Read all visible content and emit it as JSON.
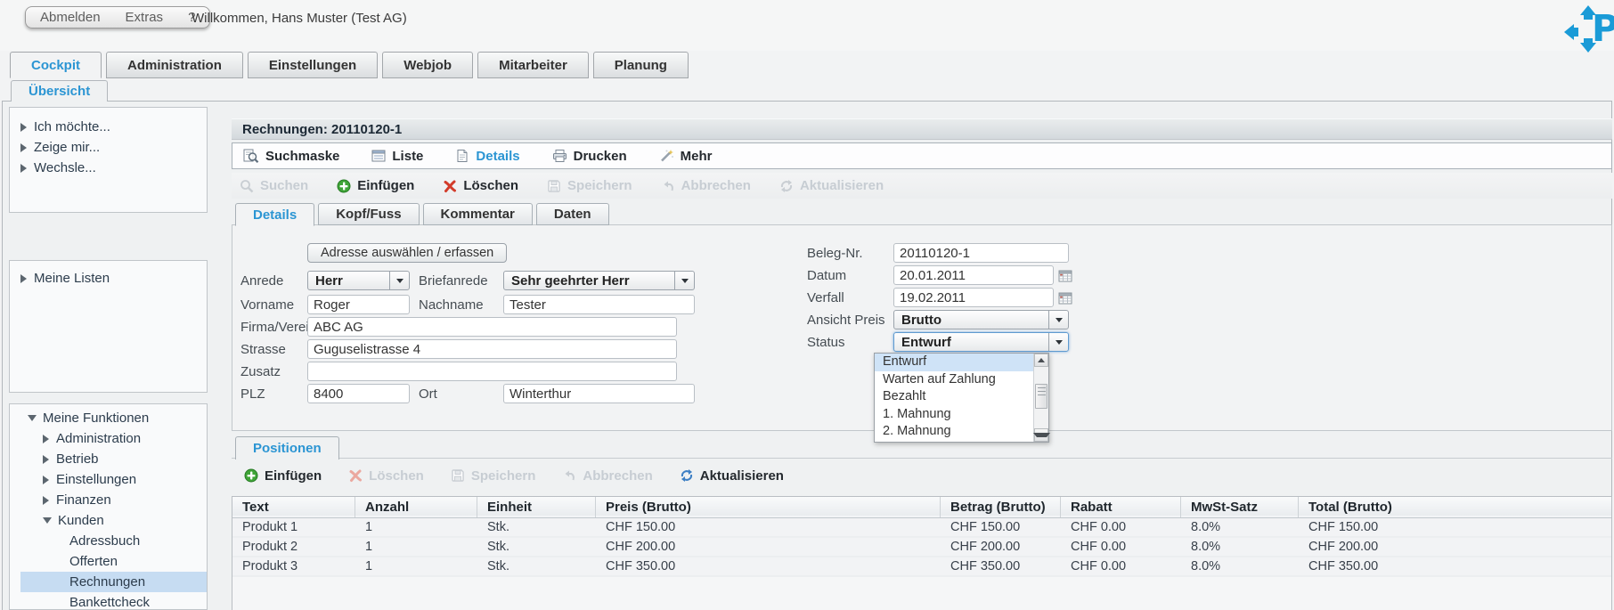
{
  "colors": {
    "accent": "#2b95d3",
    "selection": "#c6dcf2",
    "green": "#2f9e2f",
    "red": "#d23b2a",
    "refresh_blue": "#3d7fc4",
    "logo_blue": "#1a9bd7"
  },
  "top": {
    "menu": [
      {
        "label": "Abmelden"
      },
      {
        "label": "Extras"
      },
      {
        "label": "?"
      }
    ],
    "welcome": "Willkommen, Hans Muster (Test AG)",
    "logo_letter": "P"
  },
  "main_tabs": [
    {
      "label": "Cockpit"
    },
    {
      "label": "Administration"
    },
    {
      "label": "Einstellungen"
    },
    {
      "label": "Webjob"
    },
    {
      "label": "Mitarbeiter"
    },
    {
      "label": "Planung"
    }
  ],
  "subtab_label": "Übersicht",
  "sidebar": {
    "quick": [
      {
        "label": "Ich möchte..."
      },
      {
        "label": "Zeige mir..."
      },
      {
        "label": "Wechsle..."
      }
    ],
    "lists_label": "Meine Listen",
    "functions_label": "Meine Funktionen",
    "functions": [
      {
        "label": "Administration"
      },
      {
        "label": "Betrieb"
      },
      {
        "label": "Einstellungen"
      },
      {
        "label": "Finanzen"
      },
      {
        "label": "Kunden"
      }
    ],
    "kunden_children": [
      {
        "label": "Adressbuch"
      },
      {
        "label": "Offerten"
      },
      {
        "label": "Rechnungen"
      },
      {
        "label": "Bankettcheck"
      }
    ]
  },
  "record_title": "Rechnungen: 20110120-1",
  "view_toolbar": [
    {
      "label": "Suchmaske"
    },
    {
      "label": "Liste"
    },
    {
      "label": "Details"
    },
    {
      "label": "Drucken"
    },
    {
      "label": "Mehr"
    }
  ],
  "action_toolbar": [
    {
      "label": "Suchen"
    },
    {
      "label": "Einfügen"
    },
    {
      "label": "Löschen"
    },
    {
      "label": "Speichern"
    },
    {
      "label": "Abbrechen"
    },
    {
      "label": "Aktualisieren"
    }
  ],
  "detail_tabs": [
    {
      "label": "Details"
    },
    {
      "label": "Kopf/Fuss"
    },
    {
      "label": "Kommentar"
    },
    {
      "label": "Daten"
    }
  ],
  "form": {
    "address_button": "Adresse auswählen / erfassen",
    "anrede": {
      "label": "Anrede",
      "value": "Herr"
    },
    "briefanrede": {
      "label": "Briefanrede",
      "value": "Sehr geehrter Herr"
    },
    "vorname": {
      "label": "Vorname",
      "value": "Roger"
    },
    "nachname": {
      "label": "Nachname",
      "value": "Tester"
    },
    "firma": {
      "label": "Firma/Verein",
      "value": "ABC AG"
    },
    "strasse": {
      "label": "Strasse",
      "value": "Guguselistrasse 4"
    },
    "zusatz": {
      "label": "Zusatz",
      "value": ""
    },
    "plz": {
      "label": "PLZ",
      "value": "8400"
    },
    "ort": {
      "label": "Ort",
      "value": "Winterthur"
    },
    "beleg": {
      "label": "Beleg-Nr.",
      "value": "20110120-1"
    },
    "datum": {
      "label": "Datum",
      "value": "20.01.2011"
    },
    "verfall": {
      "label": "Verfall",
      "value": "19.02.2011"
    },
    "ansicht_preis": {
      "label": "Ansicht Preis",
      "value": "Brutto"
    },
    "status": {
      "label": "Status",
      "value": "Entwurf"
    }
  },
  "status_options": [
    {
      "label": "Entwurf"
    },
    {
      "label": "Warten auf Zahlung"
    },
    {
      "label": "Bezahlt"
    },
    {
      "label": "1. Mahnung"
    },
    {
      "label": "2. Mahnung"
    }
  ],
  "positions": {
    "tab_label": "Positionen",
    "toolbar": [
      {
        "label": "Einfügen"
      },
      {
        "label": "Löschen"
      },
      {
        "label": "Speichern"
      },
      {
        "label": "Abbrechen"
      },
      {
        "label": "Aktualisieren"
      }
    ],
    "columns": [
      "Text",
      "Anzahl",
      "Einheit",
      "Preis (Brutto)",
      "Betrag (Brutto)",
      "Rabatt",
      "MwSt-Satz",
      "Total (Brutto)"
    ],
    "rows": [
      [
        "Produkt 1",
        "1",
        "Stk.",
        "CHF 150.00",
        "CHF 150.00",
        "CHF 0.00",
        "8.0%",
        "CHF 150.00"
      ],
      [
        "Produkt 2",
        "1",
        "Stk.",
        "CHF 200.00",
        "CHF 200.00",
        "CHF 0.00",
        "8.0%",
        "CHF 200.00"
      ],
      [
        "Produkt 3",
        "1",
        "Stk.",
        "CHF 350.00",
        "CHF 350.00",
        "CHF 0.00",
        "8.0%",
        "CHF 350.00"
      ]
    ]
  }
}
